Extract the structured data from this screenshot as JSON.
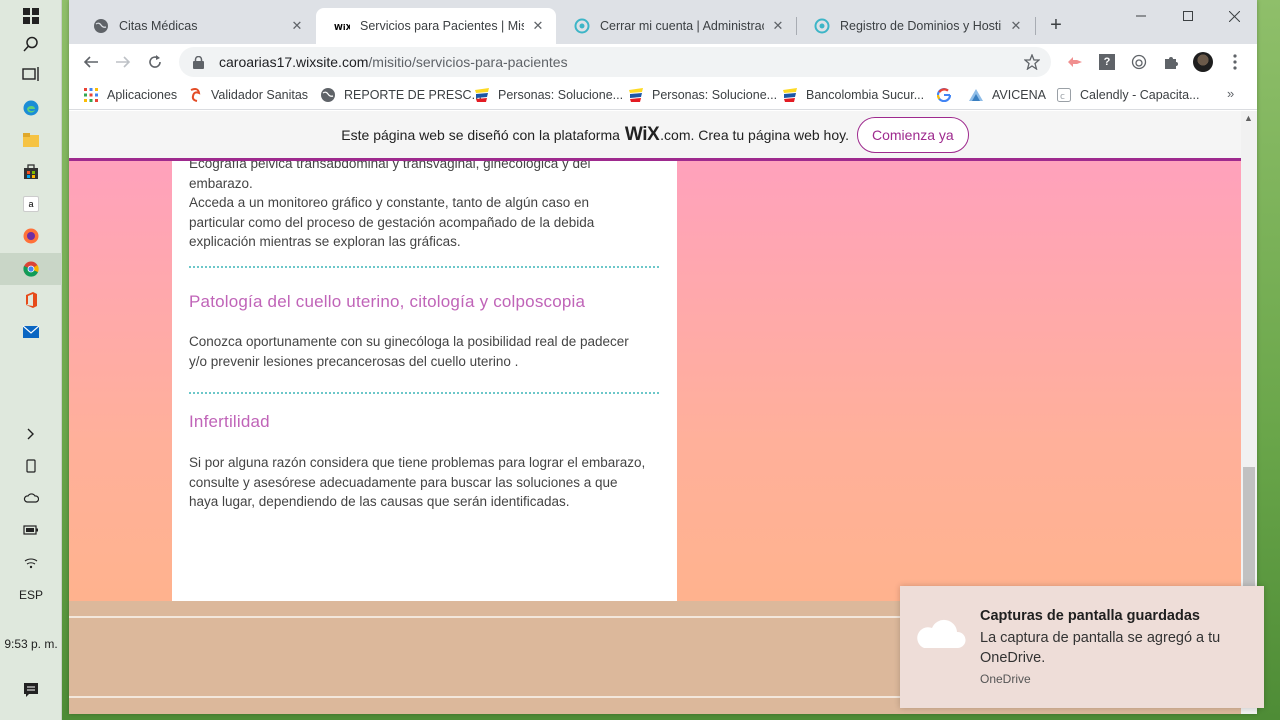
{
  "taskbar": {
    "language": "ESP",
    "clock": "9:53 p. m."
  },
  "tabs": [
    {
      "title": "Citas Médicas"
    },
    {
      "title": "Servicios para Pacientes | Misitio"
    },
    {
      "title": "Cerrar mi cuenta | Administración"
    },
    {
      "title": "Registro de Dominios y Hosting"
    }
  ],
  "address_bar": {
    "host": "caroarias17.wixsite.com",
    "path": "/misitio/servicios-para-pacientes"
  },
  "bookmarks": [
    {
      "label": "Aplicaciones"
    },
    {
      "label": "Validador Sanitas"
    },
    {
      "label": "REPORTE DE PRESC..."
    },
    {
      "label": "Personas: Solucione..."
    },
    {
      "label": "Personas: Solucione..."
    },
    {
      "label": "Bancolombia Sucur..."
    },
    {
      "label": ""
    },
    {
      "label": "AVICENA"
    },
    {
      "label": "Calendly - Capacita..."
    }
  ],
  "wix_banner": {
    "text_before": "Este página web se diseñó con la plataforma",
    "logo": "WiX",
    "text_after": ".com. Crea tu página web hoy.",
    "cta": "Comienza ya",
    "accent_color": "#9e2a8e"
  },
  "content": {
    "intro_lines": [
      "Ecografía pélvica transabdominal y transvaginal, ginecológica y del",
      "embarazo.",
      "Acceda a un monitoreo gráfico y constante, tanto de algún caso en",
      "particular como del proceso de gestación acompañado de la debida",
      "explicación mientras se exploran las gráficas."
    ],
    "sections": [
      {
        "title": "Patología del cuello uterino, citología y colposcopia",
        "lines": [
          "Conozca oportunamente con su ginecóloga la posibilidad real de padecer",
          "y/o prevenir lesiones precancerosas del cuello uterino ."
        ]
      },
      {
        "title": "Infertilidad",
        "lines": [
          "Si por alguna razón considera que tiene problemas para lograr el embarazo,",
          "consulte y asesórese adecuadamente para buscar las soluciones a que",
          "haya lugar, dependiendo de las causas que serán identificadas."
        ]
      }
    ],
    "title_color": "#c064b8",
    "divider_color": "#6cc7c9"
  },
  "toast": {
    "title": "Capturas de pantalla guardadas",
    "body": "La captura de pantalla se agregó a tu OneDrive.",
    "app": "OneDrive"
  }
}
